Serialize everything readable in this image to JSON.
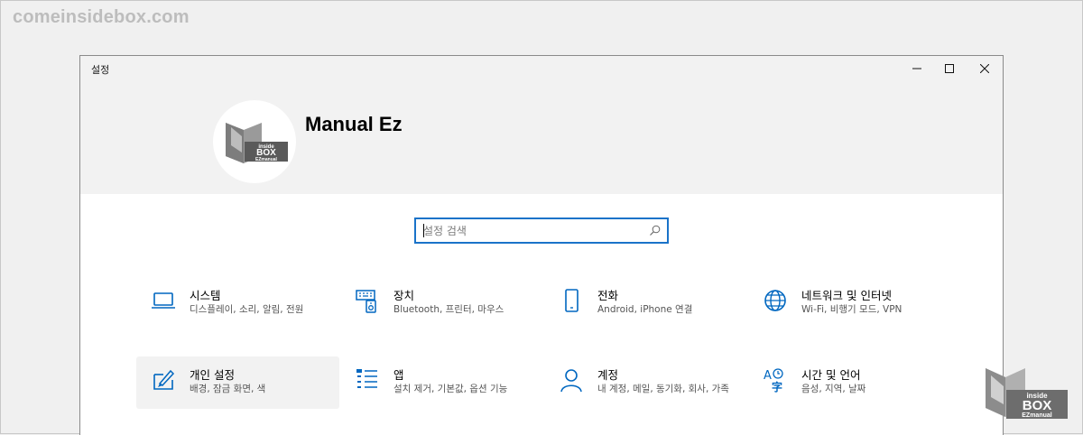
{
  "watermark": "comeinsidebox.com",
  "window": {
    "title": "설정",
    "controls": {
      "minimize": "minimize-icon",
      "maximize": "maximize-icon",
      "close": "close-icon"
    }
  },
  "profile": {
    "name": "Manual Ez",
    "avatar_logo": {
      "line1": "inside",
      "line2": "BOX",
      "line3": "EZmanual"
    }
  },
  "search": {
    "placeholder": "설정 검색",
    "value": ""
  },
  "categories": [
    {
      "title": "시스템",
      "subtitle": "디스플레이, 소리, 알림, 전원",
      "icon": "laptop-icon"
    },
    {
      "title": "장치",
      "subtitle": "Bluetooth, 프린터, 마우스",
      "icon": "devices-icon"
    },
    {
      "title": "전화",
      "subtitle": "Android, iPhone 연결",
      "icon": "phone-icon"
    },
    {
      "title": "네트워크 및 인터넷",
      "subtitle": "Wi-Fi, 비행기 모드, VPN",
      "icon": "globe-icon"
    },
    {
      "title": "개인 설정",
      "subtitle": "배경, 잠금 화면, 색",
      "icon": "personalization-icon",
      "selected": true
    },
    {
      "title": "앱",
      "subtitle": "설치 제거, 기본값, 옵션 기능",
      "icon": "apps-list-icon"
    },
    {
      "title": "계정",
      "subtitle": "내 계정, 메일, 동기화, 회사, 가족",
      "icon": "person-icon"
    },
    {
      "title": "시간 및 언어",
      "subtitle": "음성, 지역, 날짜",
      "icon": "time-language-icon"
    }
  ],
  "corner_logo": {
    "line1": "inside",
    "line2": "BOX",
    "line3": "EZmanual"
  },
  "colors": {
    "accent": "#0067c0",
    "search_border": "#1a73c9",
    "header_bg": "#f2f2f2"
  }
}
